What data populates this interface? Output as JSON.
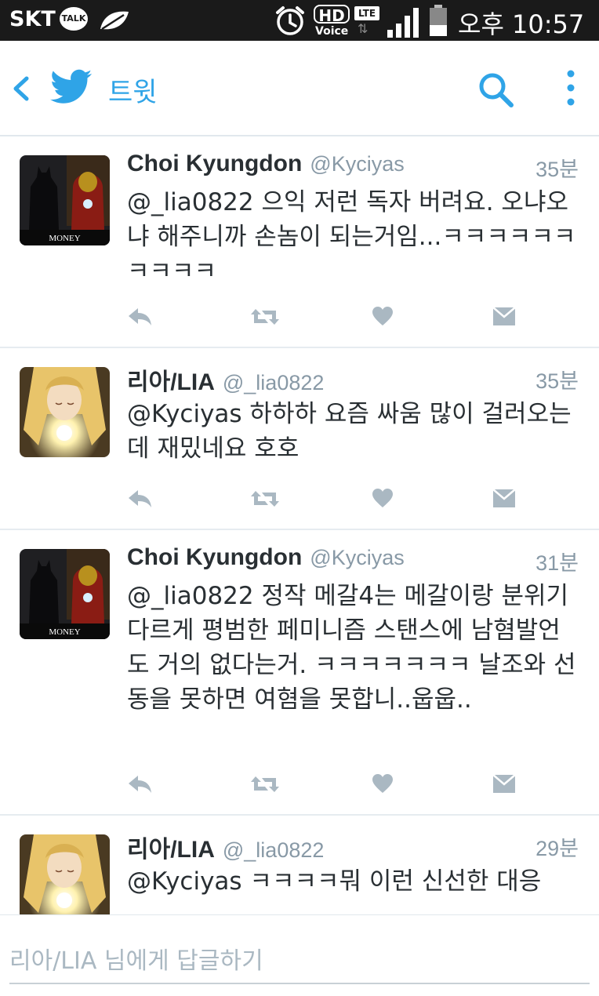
{
  "status_bar": {
    "carrier": "SKT",
    "talk_badge": "TALK",
    "hd_label": "HD",
    "voice_label": "Voice",
    "lte_label": "LTE",
    "time": "오후 10:57"
  },
  "app_bar": {
    "title": "트윗"
  },
  "tweets": [
    {
      "name": "Choi Kyungdon",
      "handle": "@Kyciyas",
      "time": "35분",
      "mention": "@_lia0822",
      "text": " 으익 저런 독자 버려요. 오냐오냐 해주니까 손놈이 되는거임...ㅋㅋㅋㅋㅋㅋㅋㅋㅋㅋ",
      "avatar_caption": "MONEY",
      "avatar": "batman-ironman"
    },
    {
      "name": "리아/LIA",
      "handle": "@_lia0822",
      "time": "35분",
      "mention": "@Kyciyas",
      "text": " 하하하 요즘 싸움 많이 걸러오는데 재밌네요 호호",
      "avatar": "anime-girl"
    },
    {
      "name": "Choi Kyungdon",
      "handle": "@Kyciyas",
      "time": "31분",
      "mention": "@_lia0822",
      "text": " 정작 메갈4는 메갈이랑 분위기 다르게 평범한 페미니즘 스탠스에 남혐발언도 거의 없다는거. ㅋㅋㅋㅋㅋㅋㅋ 날조와 선동을 못하면 여혐을 못합니..웁웁..",
      "avatar_caption": "MONEY",
      "avatar": "batman-ironman"
    },
    {
      "name": "리아/LIA",
      "handle": "@_lia0822",
      "time": "29분",
      "mention": "@Kyciyas",
      "text": " ㅋㅋㅋㅋ뭐 이런 신선한 대응",
      "avatar": "anime-girl"
    }
  ],
  "reply_bar": {
    "placeholder": "리아/LIA 님에게 답글하기"
  },
  "colors": {
    "accent": "#2fa4e7",
    "text": "#292f33",
    "muted": "#8899a6",
    "icon": "#aab8c2",
    "status_bar_bg": "#1a1a1a"
  }
}
